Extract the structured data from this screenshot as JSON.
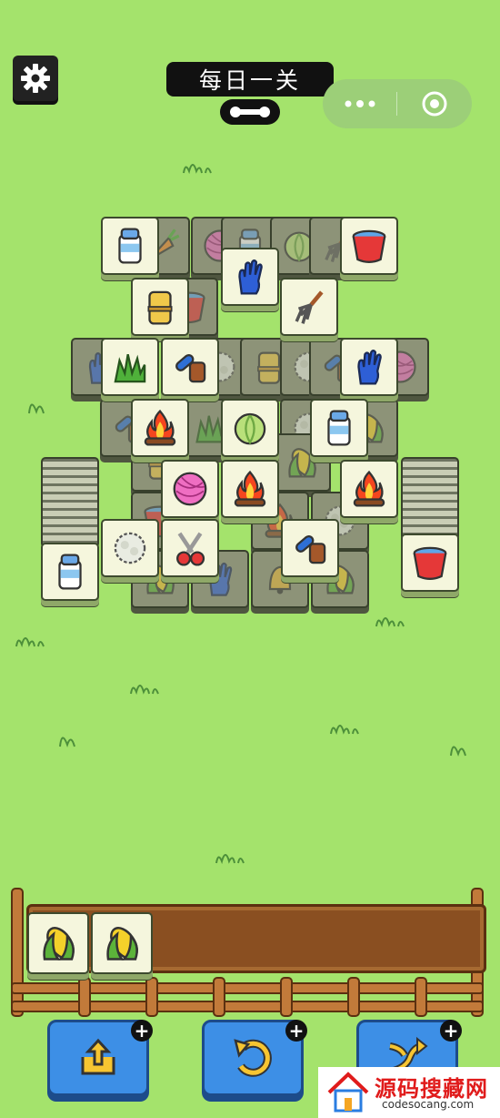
{
  "header": {
    "title": "每日一关"
  },
  "tray": {
    "slots": [
      "corn",
      "corn"
    ]
  },
  "tools": [
    {
      "name": "move-out",
      "icon": "move-out-icon"
    },
    {
      "name": "undo",
      "icon": "undo-icon"
    },
    {
      "name": "shuffle",
      "icon": "shuffle-icon"
    }
  ],
  "watermark": {
    "text": "源码搜藏网",
    "subtext": "codesocang.com"
  },
  "colors": {
    "background": "#a4e36c",
    "tile_face": "#f5f6dd",
    "tile_covered": "#8d9378",
    "button_blue": "#3d8fe6",
    "fence": "#c27a3a"
  }
}
